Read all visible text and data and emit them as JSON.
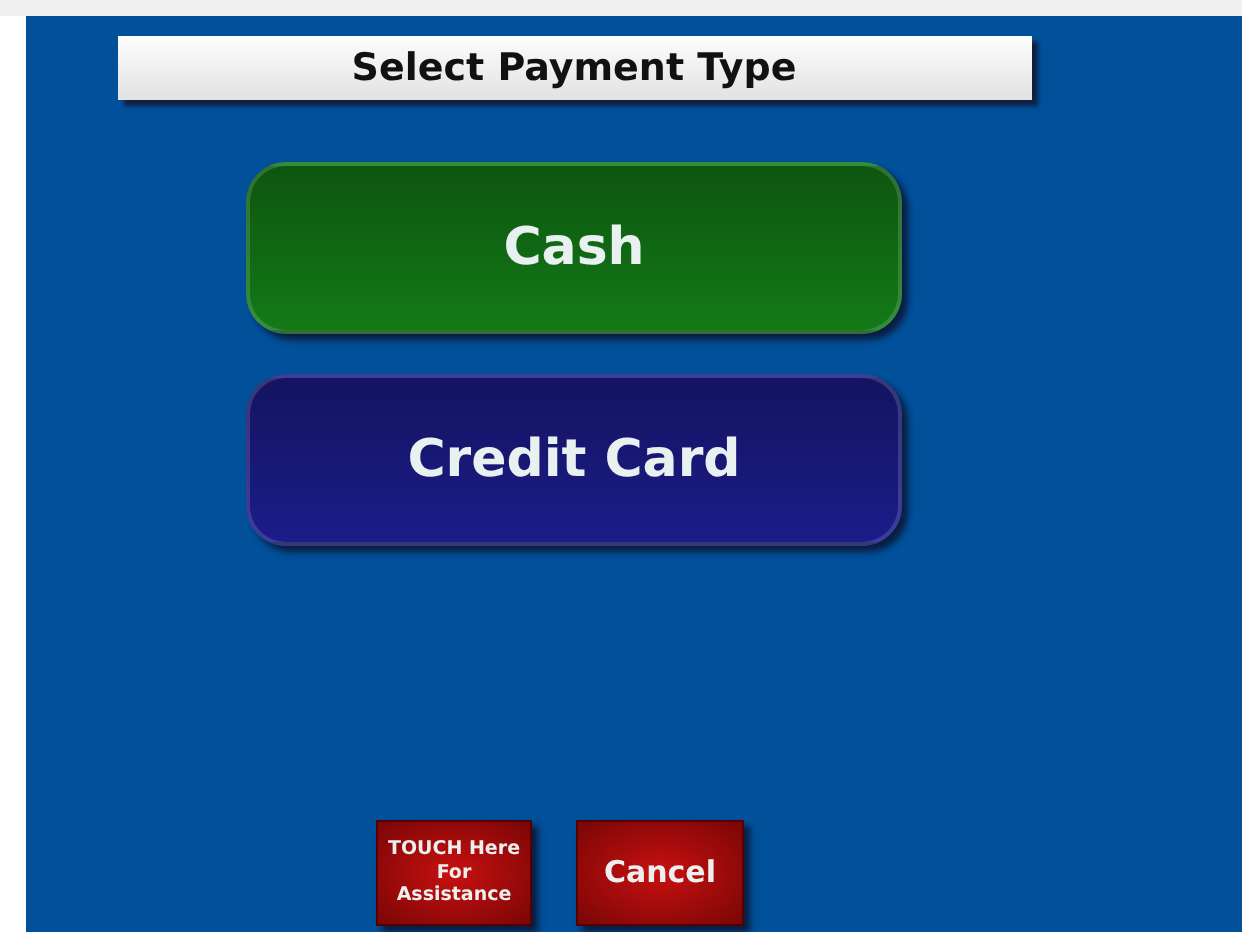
{
  "title": "Select Payment Type",
  "payment_options": [
    {
      "label": "Cash",
      "color": "#137a17"
    },
    {
      "label": "Credit Card",
      "color": "#1c1c8a"
    }
  ],
  "footer_buttons": [
    "TOUCH Here For Assistance",
    "Cancel"
  ]
}
